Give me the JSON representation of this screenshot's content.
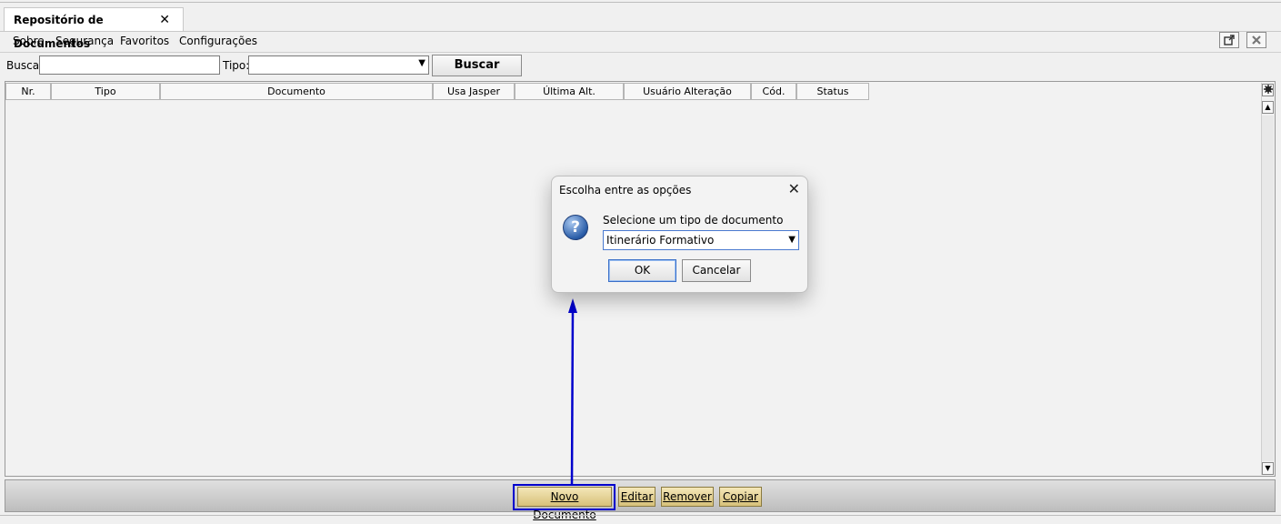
{
  "tab": {
    "title": "Repositório de Documentos",
    "close": "✕"
  },
  "menu": [
    "Sobre",
    "Segurança",
    "Favoritos",
    "Configurações"
  ],
  "search": {
    "busca_label": "Busca:",
    "tipo_label": "Tipo:",
    "buscar_button": "Buscar"
  },
  "table": {
    "columns": [
      "Nr.",
      "Tipo",
      "Documento",
      "Usa Jasper",
      "Última Alt.",
      "Usuário Alteração",
      "Cód.",
      "Status"
    ]
  },
  "actions": [
    "Novo Documento",
    "Editar",
    "Remover",
    "Copiar"
  ],
  "dialog": {
    "title": "Escolha entre as opções",
    "prompt": "Selecione um tipo de documento",
    "selected": "Itinerário Formativo",
    "ok": "OK",
    "cancel": "Cancelar"
  },
  "colors": {
    "highlight": "#0000cc",
    "arrow": "#0000cc",
    "action_button": "#e6d597"
  }
}
